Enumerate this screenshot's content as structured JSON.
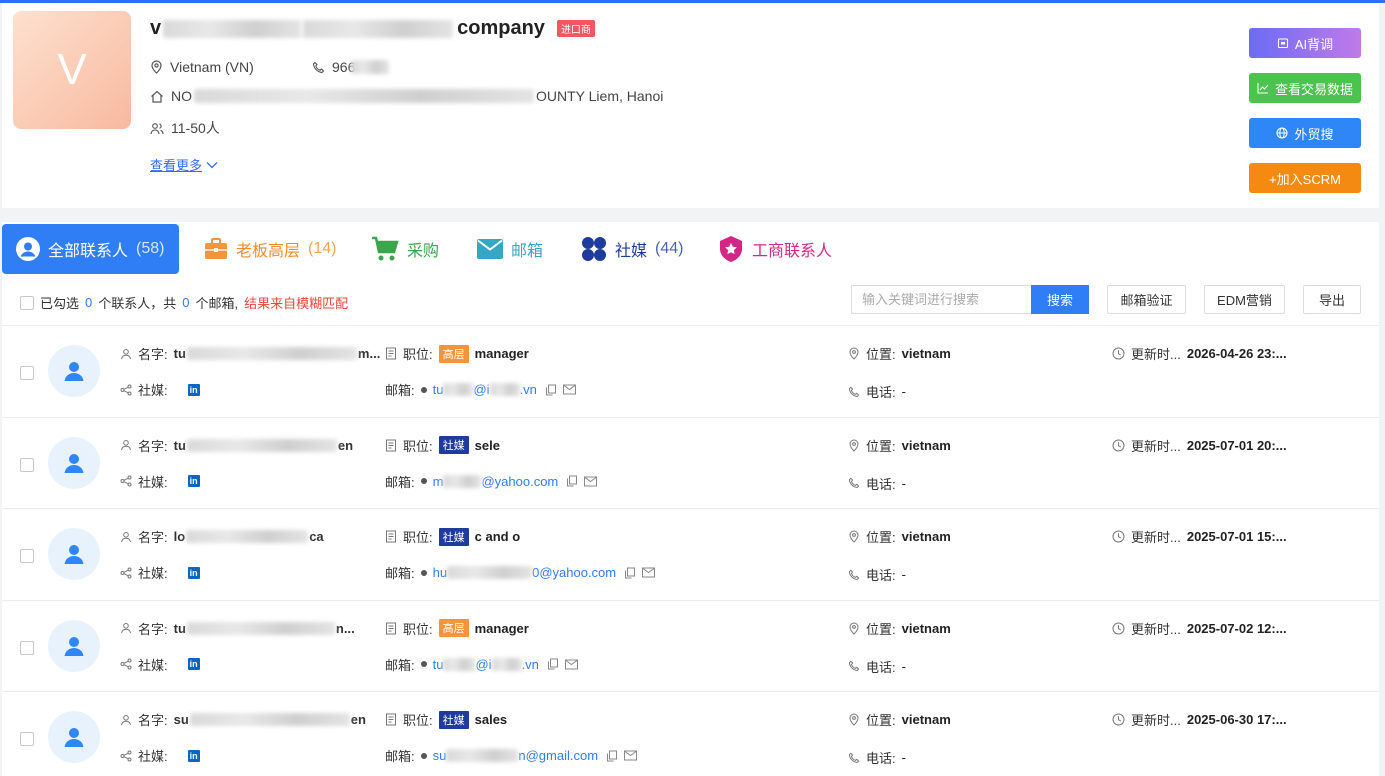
{
  "company": {
    "logo_letter": "V",
    "name_prefix": "v",
    "name_suffix": "company",
    "importer_tag": "进口商",
    "country": "Vietnam (VN)",
    "phone_prefix": "966",
    "address_prefix": "NO",
    "address_suffix": "OUNTY Liem, Hanoi",
    "size": "11-50人",
    "see_more": "查看更多"
  },
  "actions": {
    "ai": "AI背调",
    "trade": "查看交易数据",
    "search": "外贸搜",
    "scrm": "+加入SCRM"
  },
  "tabs": [
    {
      "label": "全部联系人",
      "count": "(58)"
    },
    {
      "label": "老板高层",
      "count": "(14)"
    },
    {
      "label": "采购",
      "count": ""
    },
    {
      "label": "邮箱",
      "count": ""
    },
    {
      "label": "社媒",
      "count": "(44)"
    },
    {
      "label": "工商联系人",
      "count": ""
    }
  ],
  "toolbar": {
    "selected_prefix": "已勾选",
    "selected_count": "0",
    "selected_mid": "个联系人，共",
    "email_count": "0",
    "email_suffix": "个邮箱,",
    "fuzzy_note": "结果来自模糊匹配",
    "search_placeholder": "输入关键词进行搜索",
    "search_btn": "搜索",
    "verify_btn": "邮箱验证",
    "edm_btn": "EDM营销",
    "export_btn": "导出"
  },
  "labels": {
    "name": "名字:",
    "social": "社媒:",
    "position": "职位:",
    "email": "邮箱:",
    "location": "位置:",
    "phone": "电话:",
    "updated": "更新时...",
    "linkedin": "in"
  },
  "contacts": [
    {
      "name_start": "tu",
      "name_end": "m...",
      "tag": "高层",
      "tag_type": "senior",
      "title": "manager",
      "email_start": "tu",
      "email_end": "@i",
      "email_tail": ".vn",
      "location": "vietnam",
      "phone": "-",
      "updated": "2026-04-26 23:..."
    },
    {
      "name_start": "tu",
      "name_end": "en",
      "tag": "社媒",
      "tag_type": "social",
      "title": "sele",
      "email_start": "m",
      "email_end": "@yahoo.com",
      "email_tail": "",
      "location": "vietnam",
      "phone": "-",
      "updated": "2025-07-01 20:..."
    },
    {
      "name_start": "lo",
      "name_end": "ca",
      "tag": "社媒",
      "tag_type": "social",
      "title": "c and o",
      "email_start": "hu",
      "email_end": "0@yahoo.com",
      "email_tail": "",
      "location": "vietnam",
      "phone": "-",
      "updated": "2025-07-01 15:..."
    },
    {
      "name_start": "tu",
      "name_end": "n...",
      "tag": "高层",
      "tag_type": "senior",
      "title": "manager",
      "email_start": "tu",
      "email_end": "@i",
      "email_tail": ".vn",
      "location": "vietnam",
      "phone": "-",
      "updated": "2025-07-02 12:..."
    },
    {
      "name_start": "su",
      "name_end": "en",
      "tag": "社媒",
      "tag_type": "social",
      "title": "sales",
      "email_start": "su",
      "email_end": "n@gmail.com",
      "email_tail": "",
      "location": "vietnam",
      "phone": "-",
      "updated": "2025-06-30 17:..."
    }
  ],
  "colors": {
    "primary": "#2f7ef5",
    "senior_tag": "#f5943a",
    "social_tag": "#1f3b9f",
    "importer_tag": "#f5575f"
  }
}
